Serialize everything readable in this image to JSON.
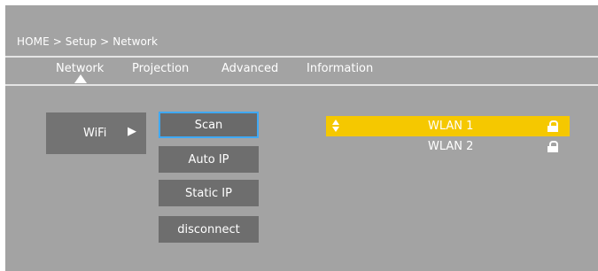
{
  "breadcrumb": {
    "text": "HOME > Setup > Network"
  },
  "tabs": [
    {
      "label": "Network",
      "active": true
    },
    {
      "label": "Projection",
      "active": false
    },
    {
      "label": "Advanced",
      "active": false
    },
    {
      "label": "Information",
      "active": false
    }
  ],
  "connection": {
    "label": "WiFi",
    "arrow": "▶"
  },
  "buttons": {
    "scan": "Scan",
    "auto_ip": "Auto IP",
    "static_ip": "Static IP",
    "disconnect": "disconnect"
  },
  "wlan": [
    {
      "name": "WLAN 1",
      "selected": true,
      "locked": true
    },
    {
      "name": "WLAN 2",
      "selected": false,
      "locked": true
    }
  ],
  "colors": {
    "background": "#a3a3a3",
    "highlight": "#f5c800",
    "focus_border": "#3fa9f5",
    "button": "#6e6e6e"
  },
  "icons": {
    "tab_pointer": "triangle-up-icon",
    "sort": "sort-arrows-icon",
    "lock": "lock-icon"
  }
}
